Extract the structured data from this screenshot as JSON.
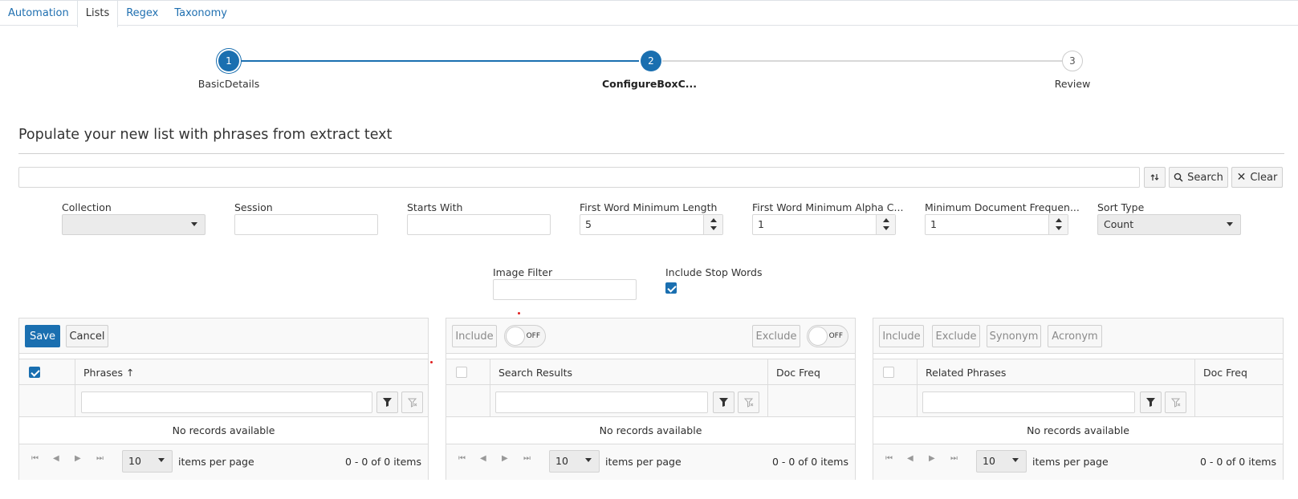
{
  "tabs": [
    {
      "label": "Automation"
    },
    {
      "label": "Lists"
    },
    {
      "label": "Regex"
    },
    {
      "label": "Taxonomy"
    }
  ],
  "stepper": {
    "steps": [
      {
        "number": "1",
        "label": "BasicDetails"
      },
      {
        "number": "2",
        "label": "ConfigureBoxC..."
      },
      {
        "number": "3",
        "label": "Review"
      }
    ]
  },
  "section_title": "Populate your new list with phrases from extract text",
  "search": {
    "value": "",
    "search_label": "Search",
    "clear_label": "Clear"
  },
  "filters": {
    "collection": {
      "label": "Collection",
      "value": ""
    },
    "session": {
      "label": "Session",
      "value": ""
    },
    "starts_with": {
      "label": "Starts With",
      "value": ""
    },
    "first_word_min_length": {
      "label": "First Word Minimum Length",
      "value": "5"
    },
    "first_word_min_alpha": {
      "label": "First Word Minimum Alpha C...",
      "value": "1"
    },
    "min_doc_freq": {
      "label": "Minimum Document Frequen...",
      "value": "1"
    },
    "sort_type": {
      "label": "Sort Type",
      "value": "Count"
    },
    "image_filter": {
      "label": "Image Filter",
      "value": ""
    },
    "include_stop_words": {
      "label": "Include Stop Words",
      "checked": true
    }
  },
  "panel_phrases": {
    "save_label": "Save",
    "cancel_label": "Cancel",
    "column": "Phrases",
    "sort_indicator": "↑",
    "no_records": "No records available",
    "page_size": "10",
    "items_per_page": "items per page",
    "count": "0 - 0 of 0 items"
  },
  "panel_search": {
    "include_label": "Include",
    "exclude_label": "Exclude",
    "toggle_off": "OFF",
    "column": "Search Results",
    "doc_freq": "Doc Freq",
    "no_records": "No records available",
    "page_size": "10",
    "items_per_page": "items per page",
    "count": "0 - 0 of 0 items"
  },
  "panel_related": {
    "include_label": "Include",
    "exclude_label": "Exclude",
    "synonym_label": "Synonym",
    "acronym_label": "Acronym",
    "column": "Related Phrases",
    "doc_freq": "Doc Freq",
    "no_records": "No records available",
    "page_size": "10",
    "items_per_page": "items per page",
    "count": "0 - 0 of 0 items"
  },
  "colors": {
    "accent": "#1a6fb0",
    "link": "#1f6fb0",
    "border": "#dcdcdc"
  }
}
